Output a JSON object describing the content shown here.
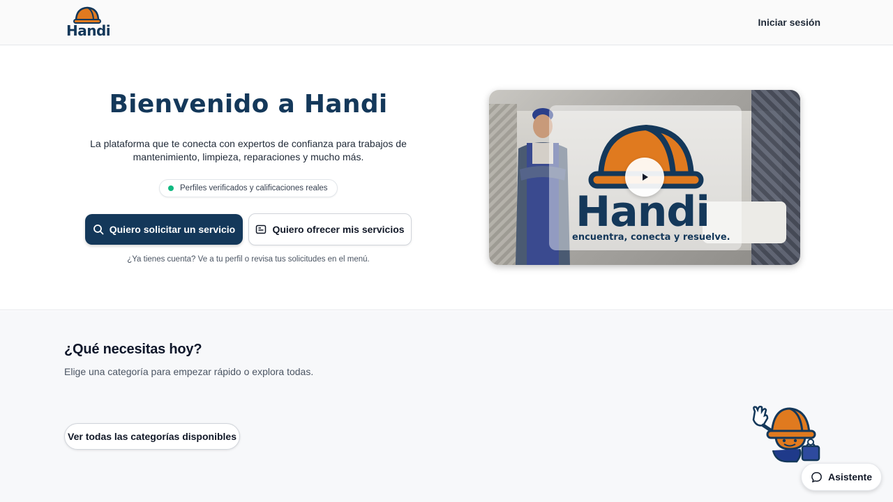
{
  "header": {
    "logo_text": "Handi",
    "login_label": "Iniciar sesión"
  },
  "hero": {
    "title": "Bienvenido a Handi",
    "subtitle": "La plataforma que te conecta con expertos de confianza para trabajos de mantenimiento, limpieza, reparaciones y mucho más.",
    "verified_badge": "Perfiles verificados y calificaciones reales",
    "primary_cta": "Quiero solicitar un servicio",
    "secondary_cta": "Quiero ofrecer mis servicios",
    "account_hint": "¿Ya tienes cuenta? Ve a tu perfil o revisa tus solicitudes en el menú."
  },
  "video": {
    "brand": "Handi",
    "tagline": "encuentra, conecta y resuelve.",
    "play_icon": "play-icon"
  },
  "categories": {
    "title": "¿Qué necesitas hoy?",
    "subtitle": "Elige una categoría para empezar rápido o explora todas.",
    "view_all_label": "Ver todas las categorías disponibles"
  },
  "assistant": {
    "label": "Asistente",
    "icon": "chat-bubble-icon"
  },
  "colors": {
    "brand_navy": "#14385a",
    "brand_orange": "#e07a1f",
    "verified_green": "#10b981"
  }
}
